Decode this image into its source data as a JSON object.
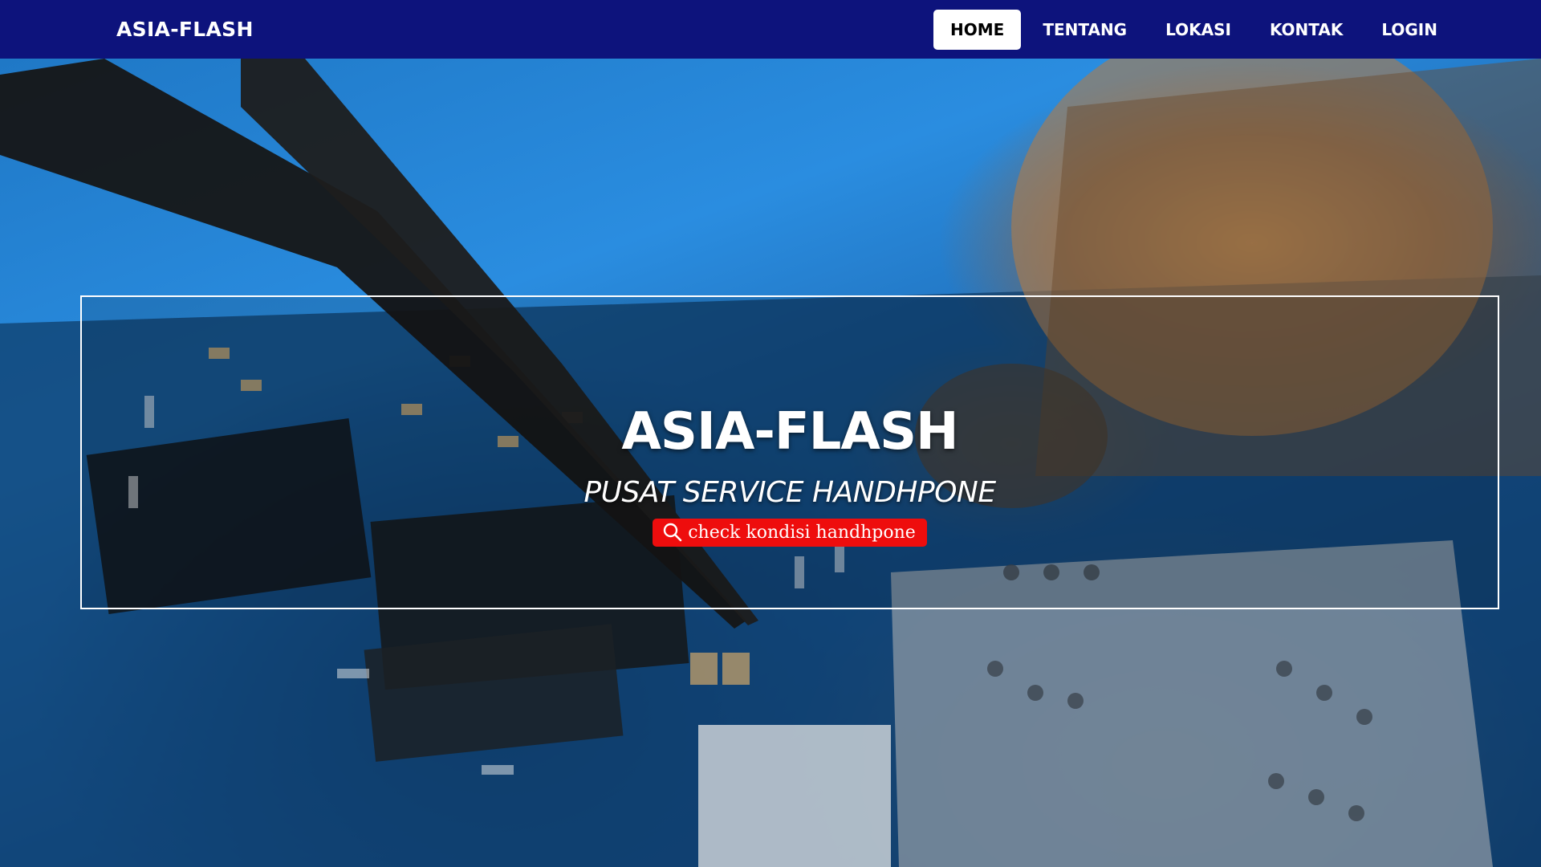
{
  "navbar": {
    "brand": "ASIA-FLASH",
    "items": [
      {
        "label": "HOME",
        "active": true
      },
      {
        "label": "TENTANG",
        "active": false
      },
      {
        "label": "LOKASI",
        "active": false
      },
      {
        "label": "KONTAK",
        "active": false
      },
      {
        "label": "LOGIN",
        "active": false
      }
    ]
  },
  "hero": {
    "title": "ASIA-FLASH",
    "subtitle": "PUSAT SERVICE HANDHPONE",
    "button_label": "check kondisi handhpone",
    "button_icon": "search-icon",
    "background": "phone-circuit-board-repair-photo"
  },
  "colors": {
    "navbar_bg": "#0d137c",
    "button_bg": "#ee0d0d",
    "active_nav_bg": "#ffffff"
  }
}
